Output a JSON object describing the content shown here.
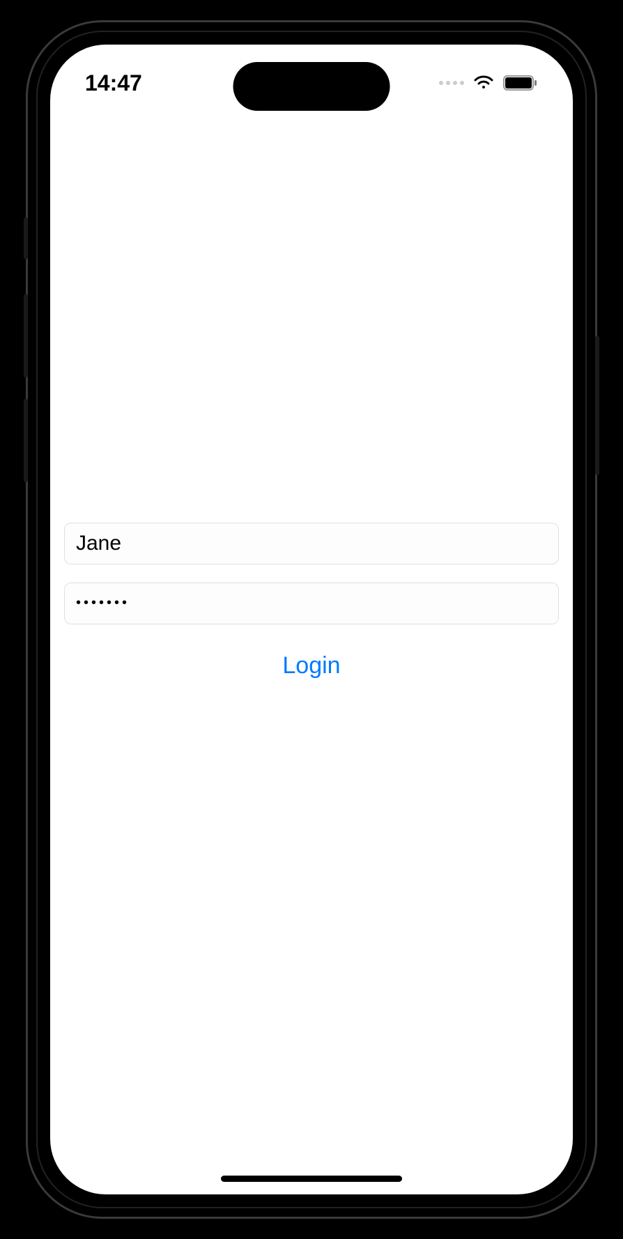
{
  "status_bar": {
    "time": "14:47"
  },
  "form": {
    "username_value": "Jane",
    "password_value": "•••••••",
    "login_label": "Login"
  }
}
